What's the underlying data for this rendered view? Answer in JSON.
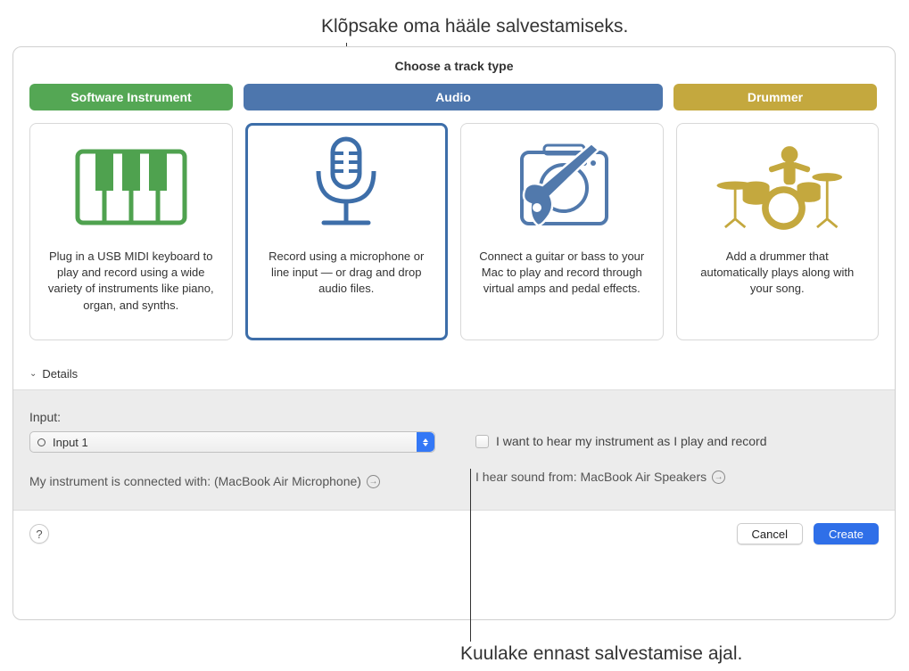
{
  "callouts": {
    "top": "Klõpsake oma hääle salvestamiseks.",
    "bottom": "Kuulake ennast salvestamise ajal."
  },
  "dialog": {
    "title": "Choose a track type",
    "categories": {
      "software": "Software Instrument",
      "audio": "Audio",
      "drummer": "Drummer"
    },
    "cards": {
      "software": "Plug in a USB MIDI keyboard to play and record using a wide variety of instruments like piano, organ, and synths.",
      "mic": "Record using a microphone or line input — or drag and drop audio files.",
      "guitar": "Connect a guitar or bass to your Mac to play and record through virtual amps and pedal effects.",
      "drummer": "Add a drummer that automatically plays along with your song."
    },
    "details_label": "Details",
    "input_label": "Input:",
    "input_value": "Input 1",
    "connection": "My instrument is connected with: (MacBook Air Microphone)",
    "monitor_label": "I want to hear my instrument as I play and record",
    "output": "I hear sound from: MacBook Air Speakers",
    "cancel": "Cancel",
    "create": "Create"
  }
}
